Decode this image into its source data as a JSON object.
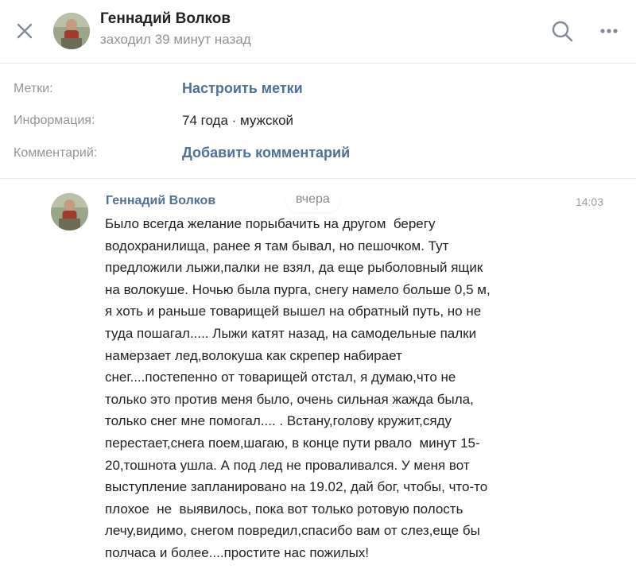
{
  "header": {
    "contact_name": "Геннадий Волков",
    "status": "заходил 39 минут назад"
  },
  "icons": {
    "close": "close-icon",
    "search": "search-icon",
    "more": "more-horizontal-icon"
  },
  "info": {
    "labels_label": "Метки:",
    "labels_action": "Настроить метки",
    "information_label": "Информация:",
    "information_value": "74 года · мужской",
    "comment_label": "Комментарий:",
    "comment_action": "Добавить комментарий"
  },
  "message": {
    "author": "Геннадий Волков",
    "date_label": "вчера",
    "time": "14:03",
    "text": "Было всегда желание порыбачить на другом  берегу\nводохранилища, ранее я там бывал, но пешочком. Тут\nпредложили лыжи,палки не взял, да еще рыболовный ящик\nна волокуше. Ночью была пурга, снегу намело больше 0,5 м,\nя хоть и раньше товарищей вышел на обратный путь, но не\nтуда пошагал..... Лыжи катят назад, на самодельные палки\nнамерзает лед,волокуша как скрепер набирает\nснег....постепенно от товарищей отстал, я думаю,что не\nтолько это против меня было, очень сильная жажда была,\nтолько снег мне помогал.... . Встану,голову кружит,сяду\nперестает,снега поем,шагаю, в конце пути рвало  минут 15-\n20,тошнота ушла. А под лед не проваливался. У меня вот\nвыступление запланировано на 19.02, дай бог, чтобы, что-то\nплохое  не  выявилось, пока вот только ротовую полость\nлечу,видимо, снегом повредил,спасибо вам от слез,еще бы\nполчаса и более....простите нас пожилых!"
  },
  "colors": {
    "link": "#4f7097",
    "muted": "#959595",
    "text": "#222222",
    "separator": "#e7e8ec"
  }
}
